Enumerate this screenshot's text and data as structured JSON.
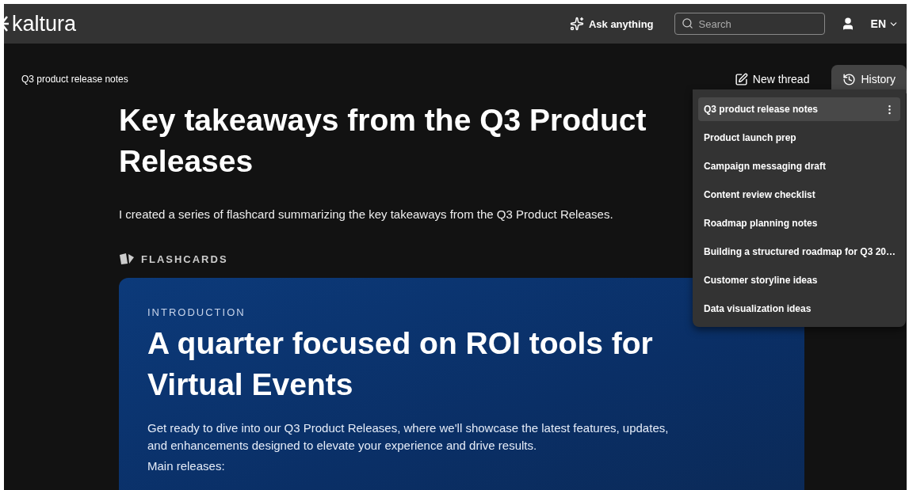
{
  "topbar": {
    "logo": "kaltura",
    "ask": "Ask anything",
    "search": {
      "placeholder": "Search"
    },
    "language": "EN"
  },
  "thread": {
    "title": "Q3 product release notes",
    "new_thread": "New thread",
    "history": {
      "label": "History",
      "selected": true
    }
  },
  "history_menu": [
    {
      "label": "Q3 product release notes",
      "selected": true
    },
    {
      "label": "Product launch prep",
      "selected": false
    },
    {
      "label": "Campaign messaging draft",
      "selected": false
    },
    {
      "label": "Content review checklist",
      "selected": false
    },
    {
      "label": "Roadmap planning notes",
      "selected": false
    },
    {
      "label": "Building a structured roadmap for Q3 20…",
      "selected": false
    },
    {
      "label": "Customer storyline ideas",
      "selected": false
    },
    {
      "label": "Data visualization ideas",
      "selected": false
    }
  ],
  "answer": {
    "heading": "Key takeaways from the Q3 Product Releases",
    "intro": "I created a series of flashcard summarizing the key takeaways from the Q3 Product Releases.",
    "section": "FLASHCARDS"
  },
  "flashcard": {
    "eyebrow": "INTRODUCTION",
    "title": "A quarter focused on ROI tools for Virtual Events",
    "body": "Get ready to dive into our Q3 Product Releases, where we'll showcase the latest features, updates, and enhancements designed to elevate your experience and drive results.",
    "list_label": "Main releases:"
  }
}
